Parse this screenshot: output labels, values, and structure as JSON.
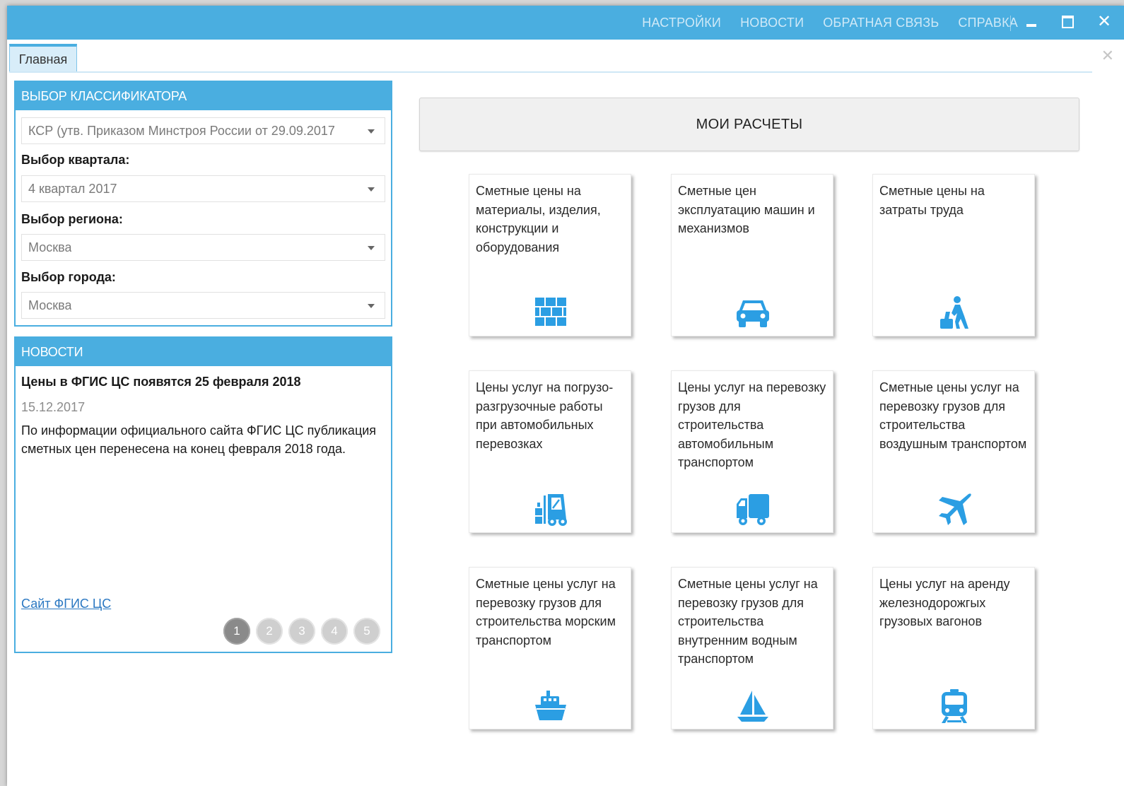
{
  "header": {
    "nav": [
      "НАСТРОЙКИ",
      "НОВОСТИ",
      "ОБРАТНАЯ СВЯЗЬ",
      "СПРАВКА"
    ],
    "window_controls": [
      "minimize-icon",
      "maximize-icon",
      "close-icon"
    ]
  },
  "tabs": [
    {
      "label": "Главная"
    }
  ],
  "classifier": {
    "heading": "ВЫБОР КЛАССИФИКАТОРА",
    "classifier_value": "КСР (утв. Приказом Минстроя России от 29.09.2017",
    "quarter_label": "Выбор квартала:",
    "quarter_value": "4 квартал 2017",
    "region_label": "Выбор региона:",
    "region_value": "Москва",
    "city_label": "Выбор города:",
    "city_value": "Москва"
  },
  "news": {
    "heading": "НОВОСТИ",
    "title": "Цены в ФГИС ЦС появятся 25 февраля 2018",
    "date": "15.12.2017",
    "body": "По информации официального сайта ФГИС ЦС публикация сметных цен перенесена на конец февраля 2018 года.",
    "link": "Сайт ФГИС ЦС",
    "pages": [
      "1",
      "2",
      "3",
      "4",
      "5"
    ],
    "active_page": "1"
  },
  "main": {
    "my_calculations": "МОИ РАСЧЕТЫ",
    "tiles": [
      {
        "label": "Сметные цены на материалы, изделия, конструкции и оборудования",
        "icon": "bricks-icon"
      },
      {
        "label": "Сметные цен эксплуатацию машин и механизмов",
        "icon": "car-icon"
      },
      {
        "label": "Сметные цены на затраты труда",
        "icon": "worker-icon"
      },
      {
        "label": "Цены услуг на погрузо-разгрузочные работы при автомобильных перевозках",
        "icon": "forklift-icon"
      },
      {
        "label": "Цены услуг на перевозку грузов для строительства автомобильным транспортом",
        "icon": "truck-icon"
      },
      {
        "label": "Сметные цены услуг на перевозку грузов для строительства воздушным транспортом",
        "icon": "airplane-icon"
      },
      {
        "label": "Сметные цены услуг на перевозку грузов для строительства морским транспортом",
        "icon": "ship-icon"
      },
      {
        "label": "Сметные цены услуг на перевозку грузов для строительства внутренним водным транспортом",
        "icon": "sailboat-icon"
      },
      {
        "label": "Цены услуг на аренду железнодорожгых грузовых вагонов",
        "icon": "train-icon"
      }
    ]
  },
  "colors": {
    "accent": "#4aaee0",
    "icon": "#2b9ee3",
    "link": "#2b78c2",
    "pager_active": "#8a8a8a",
    "pager_inactive": "#cfcfcf"
  }
}
